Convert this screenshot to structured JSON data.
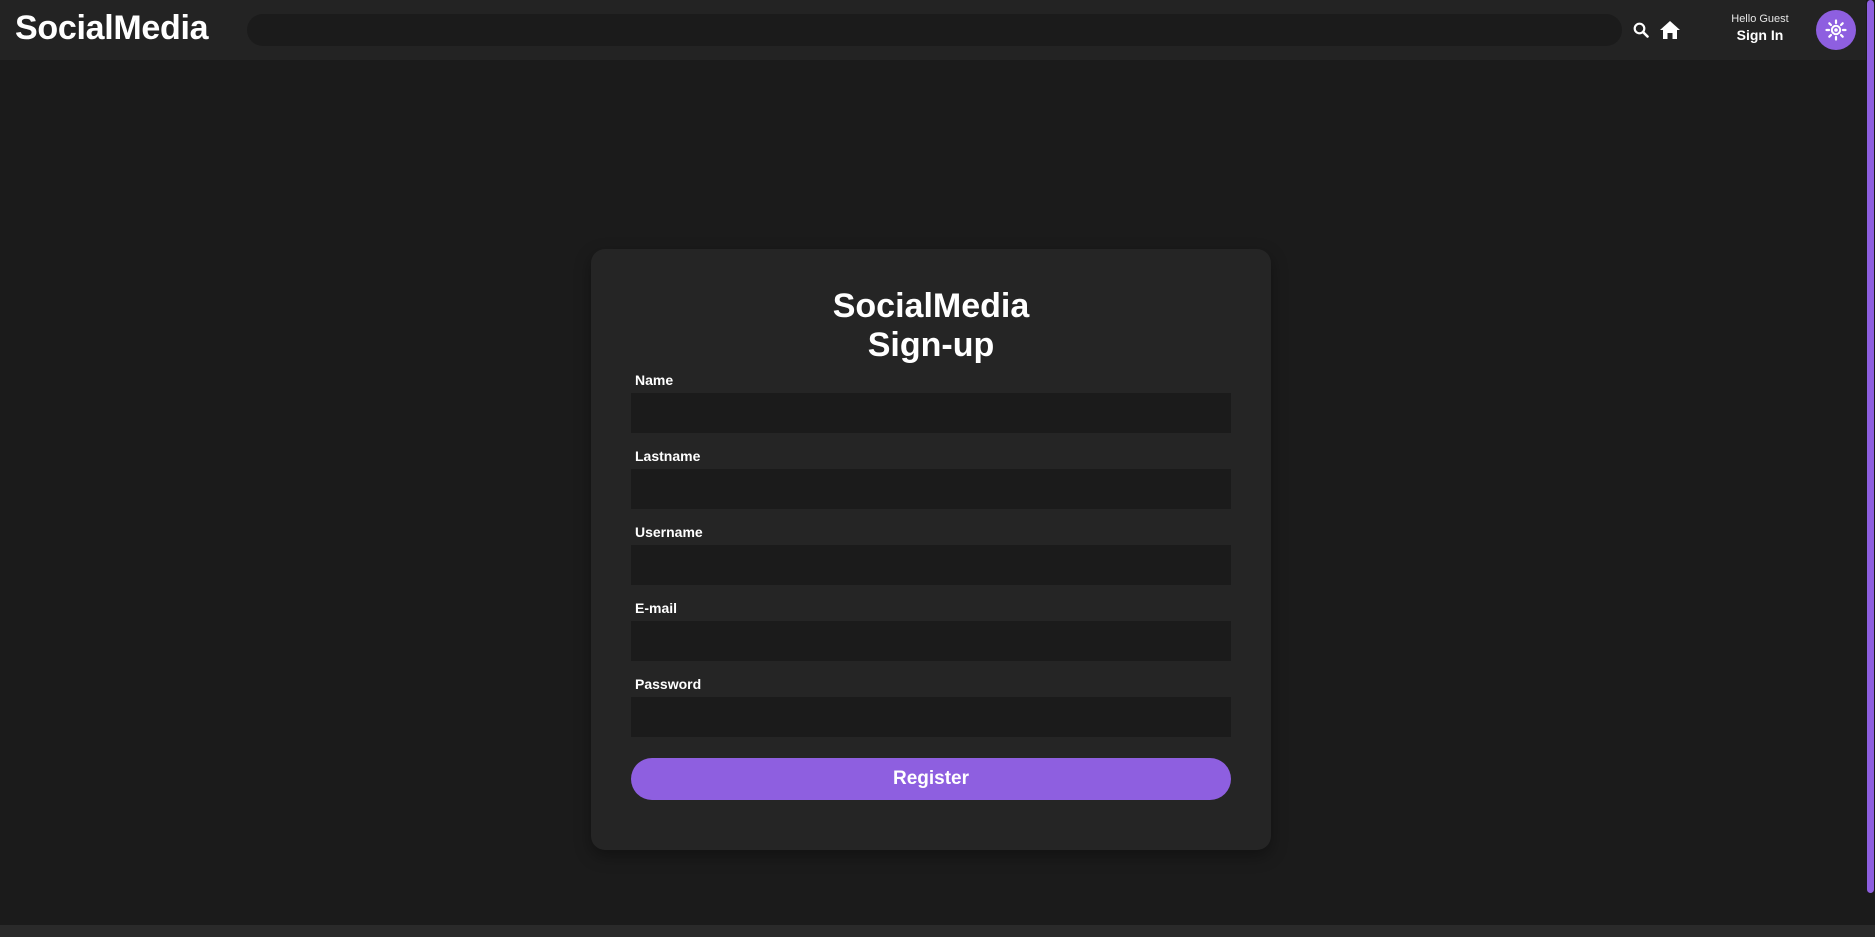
{
  "app": {
    "brand": "SocialMedia"
  },
  "header": {
    "search_placeholder": "",
    "search_icon": "search-icon",
    "home_icon": "home-icon",
    "greeting": "Hello Guest",
    "sign_in_label": "Sign In",
    "theme_icon": "sun-icon"
  },
  "form": {
    "title_line1": "SocialMedia",
    "title_line2": "Sign-up",
    "fields": [
      {
        "label": "Name",
        "value": ""
      },
      {
        "label": "Lastname",
        "value": ""
      },
      {
        "label": "Username",
        "value": ""
      },
      {
        "label": "E-mail",
        "value": ""
      },
      {
        "label": "Password",
        "value": ""
      }
    ],
    "submit_label": "Register"
  },
  "colors": {
    "background": "#1b1b1b",
    "surface": "#252525",
    "navbar": "#232323",
    "accent": "#8e5fe0",
    "text": "#ffffff"
  }
}
